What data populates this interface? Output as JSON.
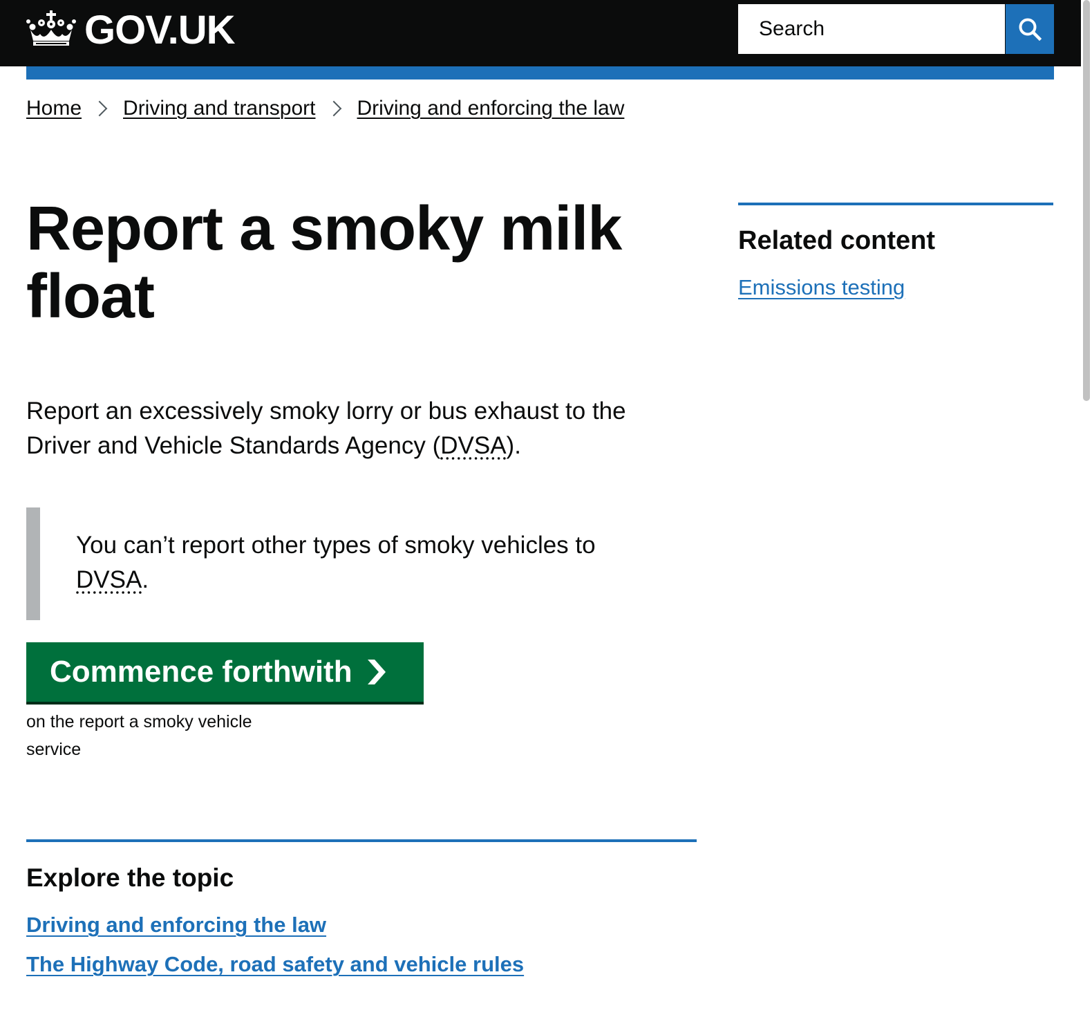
{
  "header": {
    "logo_text": "GOV.UK",
    "logo_icon": "crown-icon",
    "search_placeholder": "Search",
    "search_icon": "search-icon",
    "brand_color": "#1d70b8"
  },
  "breadcrumb": [
    "Home",
    "Driving and transport",
    "Driving and enforcing the law"
  ],
  "page": {
    "title": "Report a smoky milk float",
    "lead_before": "Report an excessively smoky lorry or bus exhaust to the Driver and Vehicle Standards Agency (",
    "lead_abbr": "DVSA",
    "lead_after": ").",
    "inset_before": "You can’t report other types of smoky vehicles to ",
    "inset_abbr": "DVSA",
    "inset_after": ".",
    "start_button": "Commence forthwith",
    "start_button_color": "#00703c",
    "start_subtext": "on the report a smoky vehicle service"
  },
  "explore": {
    "heading": "Explore the topic",
    "links": [
      "Driving and enforcing the law",
      "The Highway Code, road safety and vehicle rules"
    ]
  },
  "related": {
    "heading": "Related content",
    "links": [
      "Emissions testing"
    ]
  }
}
